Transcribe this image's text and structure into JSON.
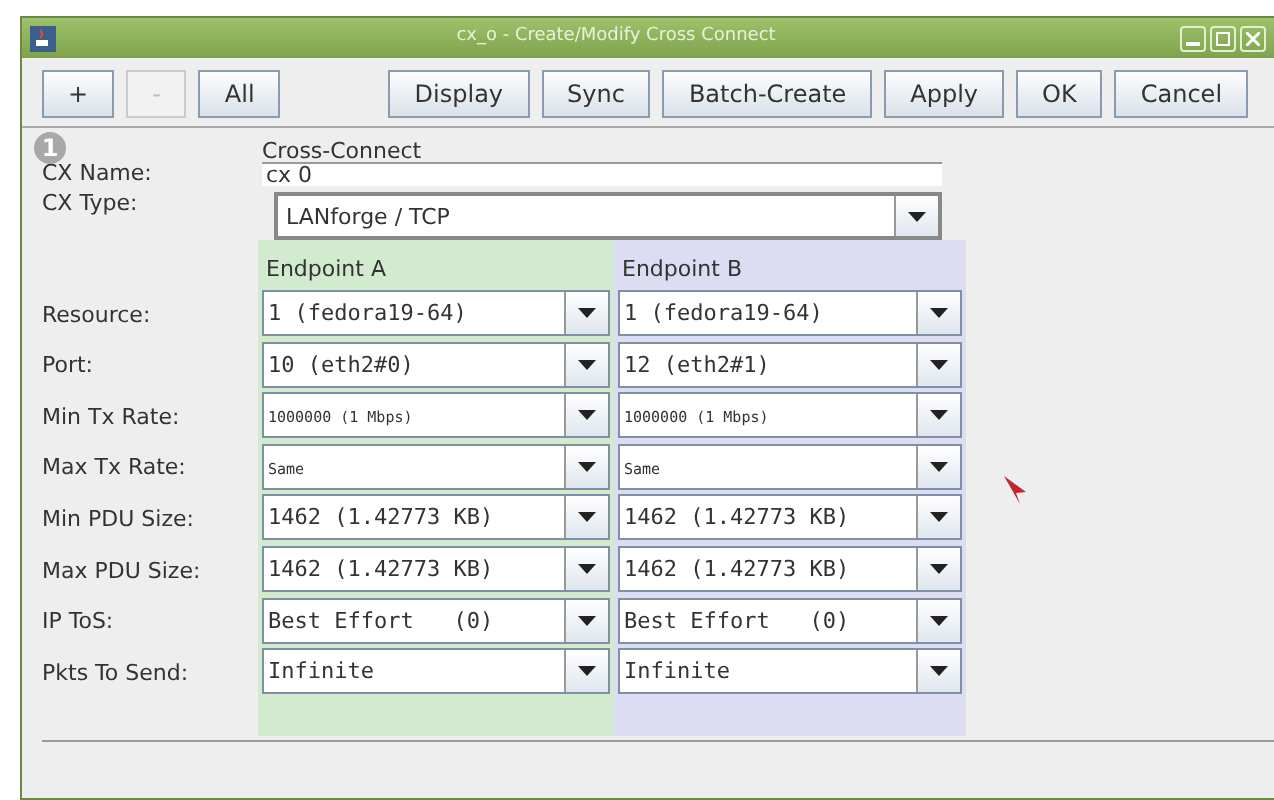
{
  "window": {
    "title": "cx_o - Create/Modify Cross Connect"
  },
  "toolbar_left": [
    {
      "label": "+",
      "disabled": false
    },
    {
      "label": "-",
      "disabled": true
    },
    {
      "label": "All",
      "disabled": false
    }
  ],
  "toolbar_right": [
    {
      "label": "Display",
      "disabled": false
    },
    {
      "label": "Sync",
      "disabled": false
    },
    {
      "label": "Batch-Create",
      "disabled": false
    },
    {
      "label": "Apply",
      "disabled": false
    },
    {
      "label": "OK",
      "disabled": false
    },
    {
      "label": "Cancel",
      "disabled": false
    }
  ],
  "step_badge": "1",
  "section_title": "Cross-Connect",
  "cx_name": {
    "label": "CX Name:",
    "value": "cx 0"
  },
  "cx_type": {
    "label": "CX Type:",
    "value": "LANforge / TCP"
  },
  "endpoints": [
    "Endpoint A",
    "Endpoint B"
  ],
  "rows": [
    {
      "label": "Resource:",
      "kind": "text",
      "values": [
        "1 (fedora19-64)",
        "1 (fedora19-64)"
      ]
    },
    {
      "label": "Port:",
      "kind": "text",
      "values": [
        "10 (eth2#0)",
        "12 (eth2#1)"
      ]
    },
    {
      "label": "Min Tx Rate:",
      "kind": "rate",
      "values": [
        "1000000 (1 Mbps)",
        "1000000 (1 Mbps)"
      ]
    },
    {
      "label": "Max Tx Rate:",
      "kind": "rate",
      "values": [
        "Same",
        "Same"
      ]
    },
    {
      "label": "Min PDU Size:",
      "kind": "text",
      "values": [
        "1462 (1.42773 KB)",
        "1462 (1.42773 KB)"
      ]
    },
    {
      "label": "Max PDU Size:",
      "kind": "text",
      "values": [
        "1462 (1.42773 KB)",
        "1462 (1.42773 KB)"
      ]
    },
    {
      "label": "IP ToS:",
      "kind": "text",
      "values": [
        "Best Effort   (0)",
        "Best Effort   (0)"
      ]
    },
    {
      "label": "Pkts To Send:",
      "kind": "text",
      "values": [
        "Infinite",
        "Infinite"
      ]
    }
  ]
}
